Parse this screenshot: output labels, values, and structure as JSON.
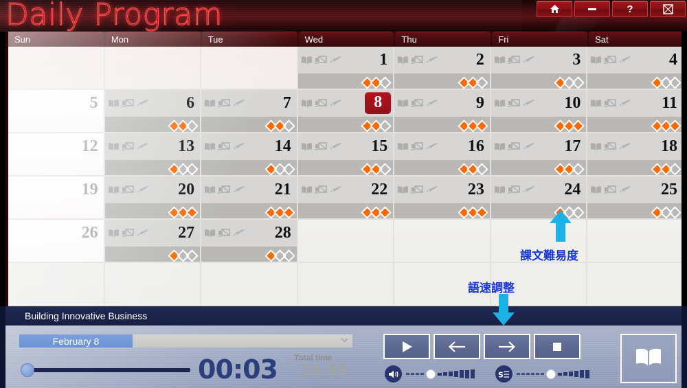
{
  "window": {
    "title": "Daily Program",
    "buttons": [
      {
        "name": "home-button",
        "icon": "home-icon",
        "label": "Home"
      },
      {
        "name": "minimize-button",
        "icon": "minimize-icon",
        "label": "Minimize"
      },
      {
        "name": "help-button",
        "icon": "help-icon",
        "label": "?"
      },
      {
        "name": "close-button",
        "icon": "close-icon",
        "label": "Close"
      }
    ]
  },
  "calendar": {
    "day_headers": [
      "Sun",
      "Mon",
      "Tue",
      "Wed",
      "Thu",
      "Fri",
      "Sat"
    ],
    "today": 8,
    "cell_icons": [
      "book-icon",
      "media-icon",
      "pencil-icon"
    ],
    "weeks": [
      [
        {
          "day": null
        },
        {
          "day": null
        },
        {
          "day": null
        },
        {
          "day": 1,
          "difficulty": 2,
          "content": true
        },
        {
          "day": 2,
          "difficulty": 2,
          "content": true
        },
        {
          "day": 3,
          "difficulty": 1,
          "content": true
        },
        {
          "day": 4,
          "difficulty": 1,
          "content": true
        }
      ],
      [
        {
          "day": 5,
          "difficulty": 0,
          "content": false
        },
        {
          "day": 6,
          "difficulty": 2,
          "content": true
        },
        {
          "day": 7,
          "difficulty": 2,
          "content": true
        },
        {
          "day": 8,
          "difficulty": 2,
          "content": true
        },
        {
          "day": 9,
          "difficulty": 3,
          "content": true
        },
        {
          "day": 10,
          "difficulty": 3,
          "content": true
        },
        {
          "day": 11,
          "difficulty": 3,
          "content": true
        }
      ],
      [
        {
          "day": 12,
          "difficulty": 0,
          "content": false
        },
        {
          "day": 13,
          "difficulty": 1,
          "content": true
        },
        {
          "day": 14,
          "difficulty": 1,
          "content": true
        },
        {
          "day": 15,
          "difficulty": 2,
          "content": true
        },
        {
          "day": 16,
          "difficulty": 2,
          "content": true
        },
        {
          "day": 17,
          "difficulty": 2,
          "content": true
        },
        {
          "day": 18,
          "difficulty": 2,
          "content": true
        }
      ],
      [
        {
          "day": 19,
          "difficulty": 0,
          "content": false
        },
        {
          "day": 20,
          "difficulty": 3,
          "content": true
        },
        {
          "day": 21,
          "difficulty": 3,
          "content": true
        },
        {
          "day": 22,
          "difficulty": 3,
          "content": true
        },
        {
          "day": 23,
          "difficulty": 3,
          "content": true
        },
        {
          "day": 24,
          "difficulty": 1,
          "content": true
        },
        {
          "day": 25,
          "difficulty": 1,
          "content": true
        }
      ],
      [
        {
          "day": 26,
          "difficulty": 0,
          "content": false
        },
        {
          "day": 27,
          "difficulty": 1,
          "content": true
        },
        {
          "day": 28,
          "difficulty": 1,
          "content": true
        },
        {
          "day": null
        },
        {
          "day": null
        },
        {
          "day": null
        },
        {
          "day": null
        }
      ],
      [
        {
          "day": null
        },
        {
          "day": null
        },
        {
          "day": null
        },
        {
          "day": null
        },
        {
          "day": null
        },
        {
          "day": null
        },
        {
          "day": null
        }
      ]
    ]
  },
  "annotations": [
    {
      "name": "difficulty-annotation",
      "text": "課文難易度",
      "color": "#1b39d6"
    },
    {
      "name": "speed-annotation",
      "text": "語速調整",
      "color": "#1b39d6"
    }
  ],
  "player": {
    "track_title": "Building Innovative Business",
    "lesson_select": {
      "value": "February 8",
      "chevron": "chevron-down-icon"
    },
    "current_time": "00:03",
    "total_time_label": "Total time",
    "total_time": "25:59",
    "seek_percent": 0,
    "transport": [
      {
        "name": "play-button",
        "icon": "play-icon"
      },
      {
        "name": "previous-button",
        "icon": "arrow-left-icon"
      },
      {
        "name": "next-button",
        "icon": "arrow-right-icon"
      },
      {
        "name": "stop-button",
        "icon": "stop-icon"
      }
    ],
    "volume_slider": {
      "name": "volume-slider",
      "icon": "speaker-icon",
      "position": 4,
      "steps": 11
    },
    "speed_slider": {
      "name": "speed-slider",
      "icon": "speed-icon",
      "position": 6,
      "steps": 12
    },
    "book_button": {
      "name": "book-button",
      "icon": "book-open-icon"
    }
  }
}
